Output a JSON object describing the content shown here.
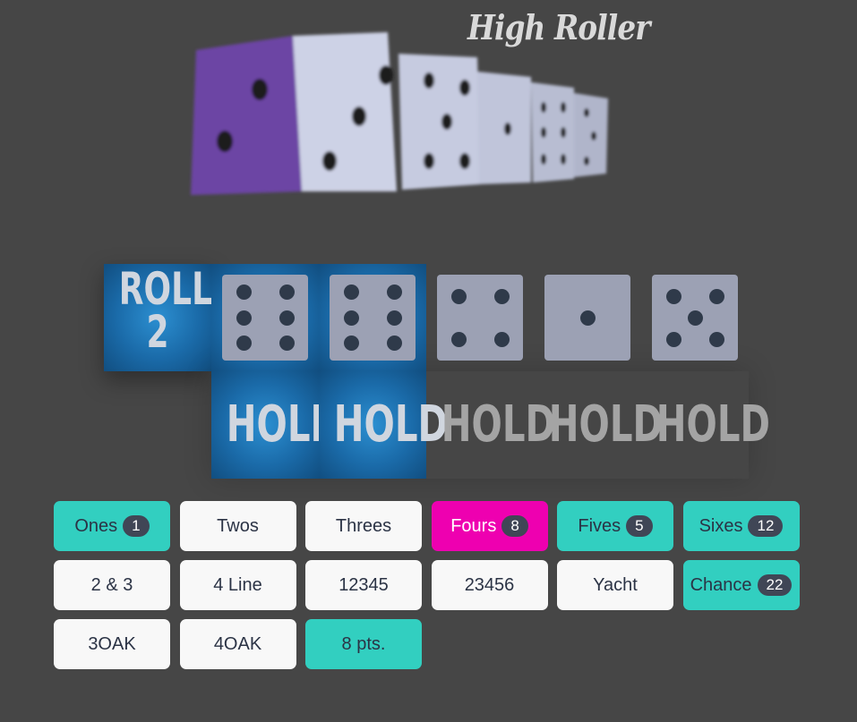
{
  "title": "High Roller",
  "roll_button": {
    "line1": "ROLL",
    "line2": "2"
  },
  "dice": [
    {
      "value": 6,
      "held": true
    },
    {
      "value": 6,
      "held": true
    },
    {
      "value": 4,
      "held": false
    },
    {
      "value": 1,
      "held": false
    },
    {
      "value": 5,
      "held": false
    }
  ],
  "hold_label": "HOLD",
  "categories": [
    {
      "label": "Ones",
      "score": "1",
      "state": "scored"
    },
    {
      "label": "Twos",
      "score": null,
      "state": "open"
    },
    {
      "label": "Threes",
      "score": null,
      "state": "open"
    },
    {
      "label": "Fours",
      "score": "8",
      "state": "selected"
    },
    {
      "label": "Fives",
      "score": "5",
      "state": "scored"
    },
    {
      "label": "Sixes",
      "score": "12",
      "state": "scored"
    },
    {
      "label": "2 & 3",
      "score": null,
      "state": "open"
    },
    {
      "label": "4 Line",
      "score": null,
      "state": "open"
    },
    {
      "label": "12345",
      "score": null,
      "state": "open"
    },
    {
      "label": "23456",
      "score": null,
      "state": "open"
    },
    {
      "label": "Yacht",
      "score": null,
      "state": "open"
    },
    {
      "label": "Chance",
      "score": "22",
      "state": "scored"
    },
    {
      "label": "3OAK",
      "score": null,
      "state": "open"
    },
    {
      "label": "4OAK",
      "score": null,
      "state": "open"
    },
    {
      "label": "8 pts.",
      "score": null,
      "state": "scored"
    }
  ],
  "colors": {
    "background": "#464646",
    "scored": "#32cfc0",
    "selected": "#ee00b0",
    "open": "#f8f8f8",
    "badge": "#404656",
    "hold_active": "#1a6aa8"
  }
}
